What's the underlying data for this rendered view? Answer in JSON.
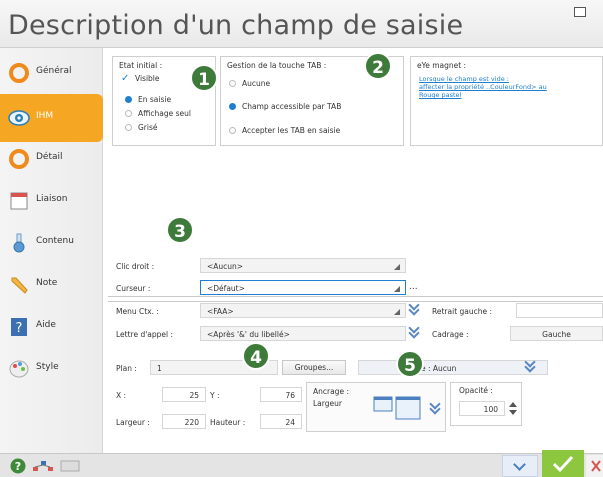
{
  "window": {
    "title": "Description d'un champ de saisie"
  },
  "sidebar": {
    "items": [
      {
        "label": "Général",
        "icon": "orange-ring-icon"
      },
      {
        "label": "IHM",
        "icon": "eye-icon",
        "active": true
      },
      {
        "label": "Détail",
        "icon": "orange-ring-icon"
      },
      {
        "label": "Liaison",
        "icon": "calendar-table-icon"
      },
      {
        "label": "Contenu",
        "icon": "flask-icon"
      },
      {
        "label": "Note",
        "icon": "pencil-icon"
      },
      {
        "label": "Aide",
        "icon": "help-icon"
      },
      {
        "label": "Style",
        "icon": "palette-icon"
      }
    ]
  },
  "etat_initial": {
    "title": "Etat initial :",
    "visible_label": "Visible",
    "options": [
      "En saisie",
      "Affichage seul",
      "Grisé"
    ],
    "selected": "En saisie"
  },
  "tab_key": {
    "title": "Gestion de la touche TAB :",
    "options": [
      "Aucune",
      "Champ accessible par TAB",
      "Accepter les TAB en saisie"
    ],
    "selected": "Champ accessible par TAB"
  },
  "magnet": {
    "title": "eYe magnet :",
    "lines": [
      "Lorsque le champ est vide :",
      "affecter la propriété ..CouleurFond> au",
      "Rouge pastel"
    ]
  },
  "form": {
    "clic_droit": {
      "label": "Clic droit :",
      "value": "<Aucun>"
    },
    "curseur": {
      "label": "Curseur :",
      "value": "<Défaut>",
      "more": "..."
    },
    "menu_ctx": {
      "label": "Menu Ctx. :",
      "value": "<FAA>"
    },
    "lettre_appel": {
      "label": "Lettre d'appel :",
      "value": "<Après '&' du libellé>"
    },
    "retrait_gauche": {
      "label": "Retrait gauche :",
      "value": ""
    },
    "cadrage": {
      "label": "Cadrage :",
      "value": "Gauche"
    }
  },
  "layout_props": {
    "plan": {
      "label": "Plan :",
      "value": "1"
    },
    "groupes_button": "Groupes...",
    "ancrage_select": "e : Aucun",
    "x": {
      "label": "X :",
      "value": "25"
    },
    "y": {
      "label": "Y :",
      "value": "76"
    },
    "largeur": {
      "label": "Largeur :",
      "value": "220"
    },
    "hauteur": {
      "label": "Hauteur :",
      "value": "24"
    },
    "ancrage": {
      "label": "Ancrage :",
      "sub": "Largeur"
    },
    "opacite": {
      "label": "Opacité :",
      "value": "100"
    }
  },
  "badges": [
    "1",
    "2",
    "3",
    "4",
    "5"
  ],
  "colors": {
    "accent": "#1f7fd0",
    "active_tab": "#f5a623",
    "badge": "#3e7a3a",
    "ok": "#8dc63f"
  }
}
